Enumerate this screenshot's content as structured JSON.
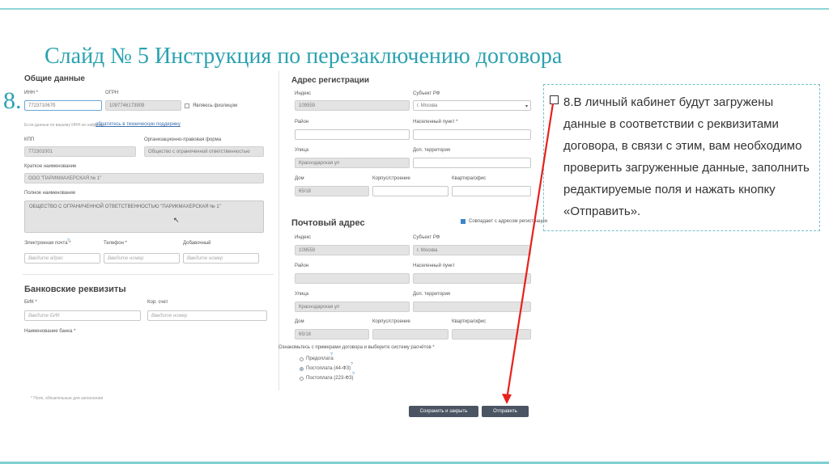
{
  "slide": {
    "title": "Слайд № 5 Инструкция по перезаключению договора",
    "step": "8."
  },
  "left": {
    "general_title": "Общие данные",
    "inn_label": "ИНН *",
    "inn_value": "772371067б",
    "ogrn_label": "ОГРН",
    "ogrn_value": "1097746173909",
    "is_individual_label": "Являюсь физлицом",
    "not_found_hint": "Если данные по вашему ИНН не найдены,",
    "support_link": "обратитесь в техническую поддержку",
    "kpp_label": "КПП",
    "kpp_value": "772301001",
    "opf_label": "Организационно-правовая форма",
    "opf_value": "Общество с ограниченной ответственностью",
    "short_name_label": "Краткое наименование",
    "short_name_value": "ООО \"ПАРИКМАХЕРСКАЯ № 1\"",
    "full_name_label": "Полное наименование",
    "full_name_value": "ОБЩЕСТВО С ОГРАНИЧЕННОЙ ОТВЕТСТВЕННОСТЬЮ \"ПАРИКМАХЕРСКАЯ № 1\"",
    "email_label": "Электронная почта *",
    "email_placeholder": "Введите адрес",
    "phone_label": "Телефон *",
    "phone_placeholder": "Введите номер",
    "ext_label": "Добавочный",
    "ext_placeholder": "Введите номер",
    "bank_title": "Банковские реквизиты",
    "bik_label": "БИК *",
    "bik_placeholder": "Введите БИК",
    "corr_label": "Кор. счет",
    "corr_placeholder": "Введите номер",
    "bank_name_label": "Наименование банка *",
    "required_note": "* Поле, обязательные для заполнения"
  },
  "reg": {
    "title": "Адрес регистрации",
    "index_label": "Индекс",
    "index_value": "109559",
    "subject_label": "Субъект РФ",
    "subject_value": "г. Москва",
    "district_label": "Район",
    "locality_label": "Населенный пункт *",
    "street_label": "Улица",
    "street_value": "Краснодарская ул",
    "territory_label": "Доп. территория",
    "house_label": "Дом",
    "house_value": "65/18",
    "building_label": "Корпус/строение",
    "apt_label": "Квартира/офис"
  },
  "post": {
    "title": "Почтовый адрес",
    "same_label": "Совпадает с адресом регистрации",
    "index_label": "Индекс",
    "index_value": "109559",
    "subject_label": "Субъект РФ",
    "subject_value": "г. Москва",
    "district_label": "Район",
    "locality_label": "Населенный пункт",
    "street_label": "Улица",
    "street_value": "Краснодарская ул",
    "territory_label": "Доп. территория",
    "house_label": "Дом",
    "house_value": "65/18",
    "building_label": "Корпус/строение",
    "apt_label": "Квартира/офис"
  },
  "payment": {
    "prompt": "Ознакомьтесь с примерами договора и выберите систему расчётов *",
    "options": [
      "Предоплата",
      "Постоплата (44-ФЗ)",
      "Постоплата (223-ФЗ)"
    ]
  },
  "buttons": {
    "save_close": "Сохранить и закрыть",
    "submit": "Отправить"
  },
  "note": {
    "text": "8.В личный кабинет будут загружены данные в соответствии с реквизитами договора, в связи с этим, вам необходимо проверить загруженные данные, заполнить редактируемые поля и нажать кнопку «Отправить»."
  },
  "colors": {
    "title": "#2aa2b0",
    "arrow": "#e8201c",
    "button": "#4a5462"
  }
}
